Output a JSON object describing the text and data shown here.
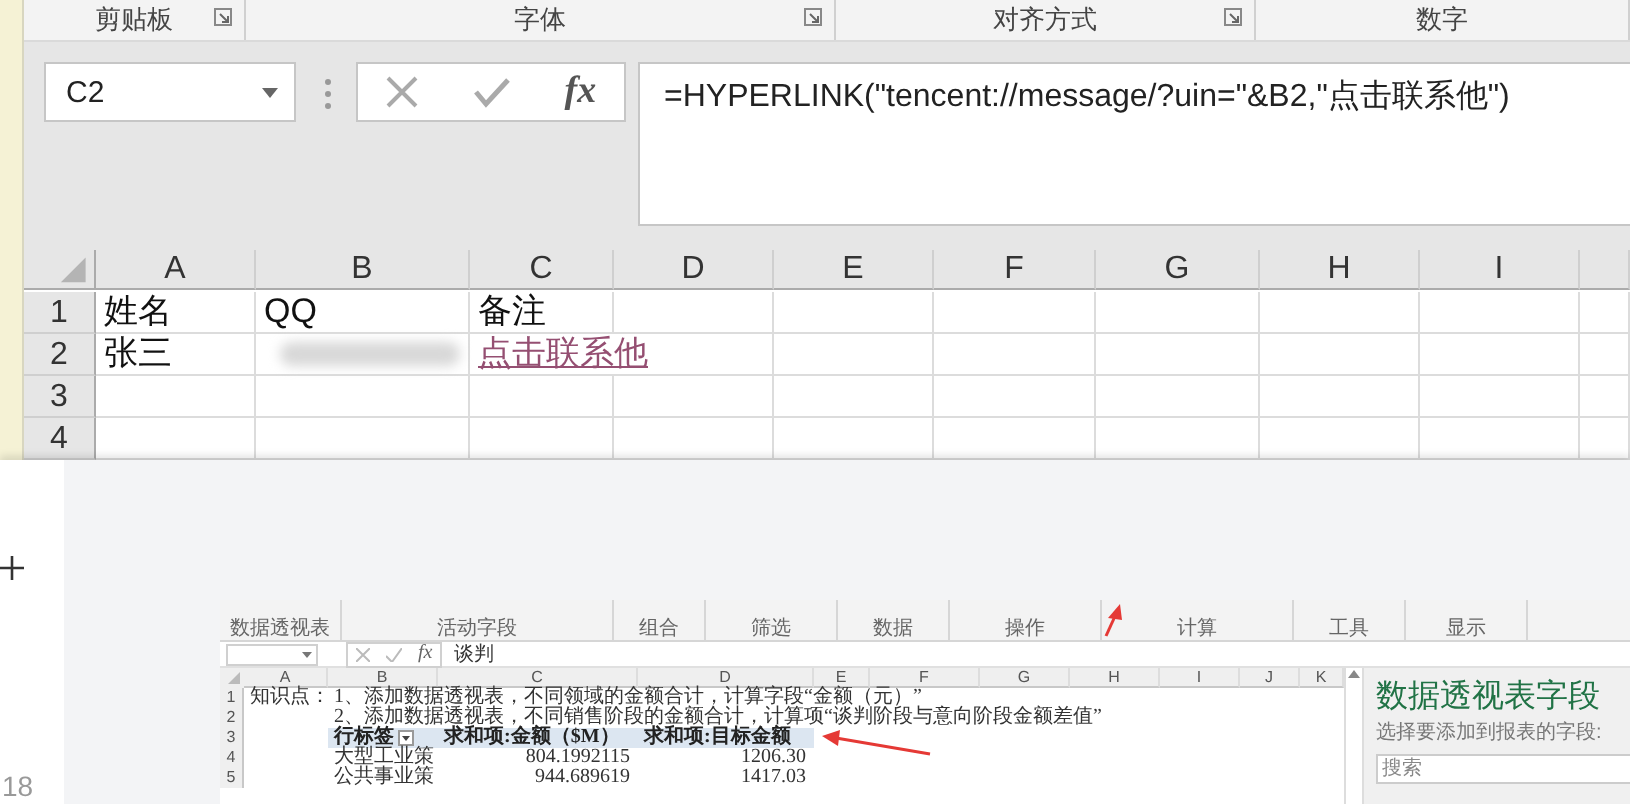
{
  "spreadsheet": {
    "ribbon_groups": [
      {
        "label": "剪贴板",
        "launcher": true
      },
      {
        "label": "字体",
        "launcher": true
      },
      {
        "label": "对齐方式",
        "launcher": true
      },
      {
        "label": "数字",
        "launcher": false
      }
    ],
    "name_box": "C2",
    "function_button": "fx",
    "formula": "=HYPERLINK(\"tencent://message/?uin=\"&B2,\"点击联系他\")",
    "columns": [
      "A",
      "B",
      "C",
      "D",
      "E",
      "F",
      "G",
      "H",
      "I"
    ],
    "rows": [
      {
        "number": "1",
        "cells": [
          {
            "kind": "text",
            "text": "姓名"
          },
          {
            "kind": "text",
            "text": "QQ"
          },
          {
            "kind": "text",
            "text": "备注"
          }
        ]
      },
      {
        "number": "2",
        "cells": [
          {
            "kind": "text",
            "text": "张三"
          },
          {
            "kind": "blurred"
          },
          {
            "kind": "link",
            "text": "点击联系他"
          }
        ]
      },
      {
        "number": "3"
      },
      {
        "number": "4"
      }
    ]
  },
  "document": {
    "page_number": "18",
    "embedded_screenshot": {
      "ribbon_groups": [
        "数据透视表",
        "活动字段",
        "组合",
        "筛选",
        "数据",
        "操作",
        "计算",
        "工具",
        "显示"
      ],
      "function_button": "fx",
      "formula": "谈判",
      "columns": [
        "A",
        "B",
        "C",
        "D",
        "E",
        "F",
        "G",
        "H",
        "I",
        "J",
        "K"
      ],
      "rows": [
        {
          "number": "1",
          "cells": [
            {
              "kind": "text",
              "text": "知识点："
            },
            {
              "kind": "text",
              "text": "1、添加数据透视表，不同领域的金额合计，计算字段“金额（元）”"
            }
          ]
        },
        {
          "number": "2",
          "cells": [
            {
              "kind": "blank"
            },
            {
              "kind": "text",
              "text": "2、添加数据透视表，不同销售阶段的金额合计，计算项“谈判阶段与意向阶段金额差值”"
            }
          ]
        },
        {
          "number": "3",
          "cells": [
            {
              "kind": "blank"
            },
            {
              "kind": "pivot-header",
              "text": "行标签",
              "filter": true
            },
            {
              "kind": "pivot-header",
              "text": "求和项:金额（$M）"
            },
            {
              "kind": "pivot-header",
              "text": "求和项:目标金额"
            }
          ]
        },
        {
          "number": "4",
          "cells": [
            {
              "kind": "blank"
            },
            {
              "kind": "text",
              "text": "大型工业策"
            },
            {
              "kind": "number",
              "text": "804.1992115"
            },
            {
              "kind": "number",
              "text": "1206.30"
            }
          ]
        },
        {
          "number": "5",
          "cells": [
            {
              "kind": "blank"
            },
            {
              "kind": "text",
              "text": "公共事业策"
            },
            {
              "kind": "number",
              "text": "944.689619"
            },
            {
              "kind": "number",
              "text": "1417.03"
            }
          ]
        }
      ],
      "pivot_panel": {
        "title": "数据透视表字段",
        "hint": "选择要添加到报表的字段:",
        "search": {
          "placeholder": "搜索"
        }
      }
    }
  }
}
